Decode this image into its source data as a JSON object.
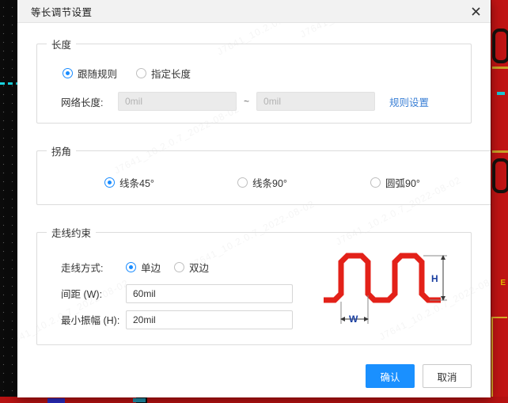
{
  "dialog": {
    "title": "等长调节设置",
    "close_icon": "close-icon"
  },
  "length": {
    "legend": "长度",
    "mode_options": [
      {
        "label": "跟随规则",
        "selected": true
      },
      {
        "label": "指定长度",
        "selected": false
      }
    ],
    "net_length_label": "网络长度:",
    "min_value": "",
    "min_placeholder": "0mil",
    "separator": "~",
    "max_value": "",
    "max_placeholder": "0mil",
    "rule_link": "规则设置"
  },
  "corner": {
    "legend": "拐角",
    "options": [
      {
        "label": "线条45°",
        "selected": true
      },
      {
        "label": "线条90°",
        "selected": false
      },
      {
        "label": "圆弧90°",
        "selected": false
      }
    ]
  },
  "route": {
    "legend": "走线约束",
    "mode_label": "走线方式:",
    "mode_options": [
      {
        "label": "单边",
        "selected": true
      },
      {
        "label": "双边",
        "selected": false
      }
    ],
    "spacing_label": "间距 (W):",
    "spacing_value": "60mil",
    "amplitude_label": "最小振幅 (H):",
    "amplitude_value": "20mil",
    "figure": {
      "name": "serpentine-trace-diagram",
      "trace_color": "#e32119",
      "dimension_color": "#1a3fa0",
      "width_label": "W",
      "height_label": "H"
    }
  },
  "footer": {
    "confirm_label": "确认",
    "cancel_label": "取消"
  },
  "watermark": {
    "text": "J7641_10.2.0.7_2022-08-02"
  },
  "colors": {
    "accent": "#1a90ff",
    "link": "#3a7fd5",
    "titlebar": "#f2f2f2",
    "pcb_red": "#c01414",
    "pcb_dark": "#0b0b0b"
  }
}
